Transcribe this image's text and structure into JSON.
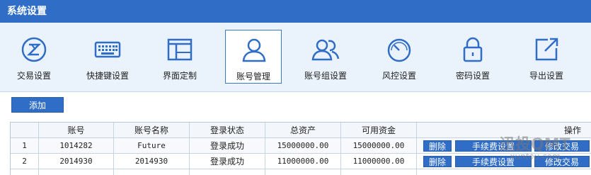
{
  "window": {
    "title": "系统设置"
  },
  "toolbar": {
    "items": [
      {
        "label": "交易设置",
        "icon": "trade-settings-icon"
      },
      {
        "label": "快捷键设置",
        "icon": "keyboard-icon"
      },
      {
        "label": "界面定制",
        "icon": "layout-icon"
      },
      {
        "label": "账号管理",
        "icon": "user-icon",
        "active": true
      },
      {
        "label": "账号组设置",
        "icon": "user-group-icon"
      },
      {
        "label": "风控设置",
        "icon": "gauge-icon"
      },
      {
        "label": "密码设置",
        "icon": "lock-icon"
      },
      {
        "label": "导出设置",
        "icon": "export-icon"
      }
    ]
  },
  "actions": {
    "add_label": "添加"
  },
  "table": {
    "columns": [
      "",
      "账号",
      "账号名称",
      "登录状态",
      "总资产",
      "可用资金",
      "操作"
    ],
    "rows": [
      {
        "index": "1",
        "account": "1014282",
        "name": "Future",
        "status": "登录成功",
        "total_assets": "15000000.00",
        "available_funds": "15000000.00",
        "ops": [
          "删除",
          "手续费设置",
          "修改交易"
        ]
      },
      {
        "index": "2",
        "account": "2014930",
        "name": "2014930",
        "status": "登录成功",
        "total_assets": "11000000.00",
        "available_funds": "11000000.00",
        "ops": [
          "删除",
          "手续费设置",
          "修改交易"
        ]
      }
    ]
  },
  "watermark": {
    "line1": "迅投QMT",
    "line2": "xuntou.com"
  },
  "colors": {
    "accent": "#2f6dc7",
    "toolbar_bg": "#eaf2fb",
    "border": "#c7d3e3"
  }
}
